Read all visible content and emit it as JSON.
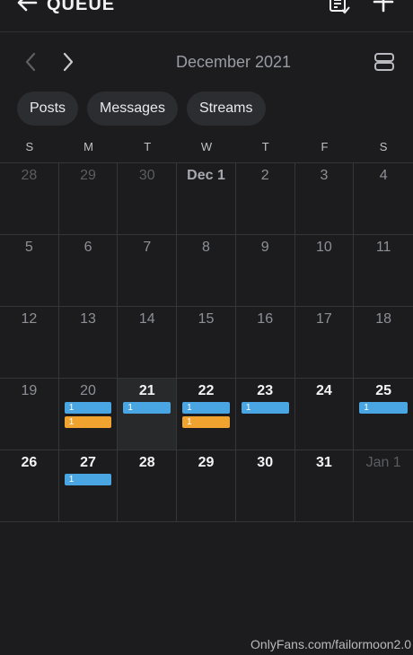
{
  "header": {
    "title": "QUEUE",
    "back_icon": "back-arrow-icon",
    "list_icon": "list-icon",
    "add_icon": "plus-icon"
  },
  "month_nav": {
    "label": "December 2021",
    "prev_icon": "chevron-left-icon",
    "next_icon": "chevron-right-icon",
    "view_icon": "calendar-view-icon"
  },
  "filters": [
    "Posts",
    "Messages",
    "Streams"
  ],
  "weekdays": [
    "S",
    "M",
    "T",
    "W",
    "T",
    "F",
    "S"
  ],
  "days": [
    {
      "label": "28",
      "style": "other",
      "badges": []
    },
    {
      "label": "29",
      "style": "other",
      "badges": []
    },
    {
      "label": "30",
      "style": "other",
      "badges": []
    },
    {
      "label": "Dec 1",
      "style": "month-start",
      "badges": []
    },
    {
      "label": "2",
      "style": "normal",
      "badges": []
    },
    {
      "label": "3",
      "style": "normal",
      "badges": []
    },
    {
      "label": "4",
      "style": "normal",
      "badges": []
    },
    {
      "label": "5",
      "style": "normal",
      "badges": []
    },
    {
      "label": "6",
      "style": "normal",
      "badges": []
    },
    {
      "label": "7",
      "style": "normal",
      "badges": []
    },
    {
      "label": "8",
      "style": "normal",
      "badges": []
    },
    {
      "label": "9",
      "style": "normal",
      "badges": []
    },
    {
      "label": "10",
      "style": "normal",
      "badges": []
    },
    {
      "label": "11",
      "style": "normal",
      "badges": []
    },
    {
      "label": "12",
      "style": "normal",
      "badges": []
    },
    {
      "label": "13",
      "style": "normal",
      "badges": []
    },
    {
      "label": "14",
      "style": "normal",
      "badges": []
    },
    {
      "label": "15",
      "style": "normal",
      "badges": []
    },
    {
      "label": "16",
      "style": "normal",
      "badges": []
    },
    {
      "label": "17",
      "style": "normal",
      "badges": []
    },
    {
      "label": "18",
      "style": "normal",
      "badges": []
    },
    {
      "label": "19",
      "style": "normal",
      "badges": []
    },
    {
      "label": "20",
      "style": "normal",
      "badges": [
        {
          "text": "1",
          "color": "blue"
        },
        {
          "text": "1",
          "color": "orange"
        }
      ]
    },
    {
      "label": "21",
      "style": "bright",
      "selected": true,
      "badges": [
        {
          "text": "1",
          "color": "blue"
        }
      ]
    },
    {
      "label": "22",
      "style": "bright",
      "badges": [
        {
          "text": "1",
          "color": "blue"
        },
        {
          "text": "1",
          "color": "orange"
        }
      ]
    },
    {
      "label": "23",
      "style": "bright",
      "badges": [
        {
          "text": "1",
          "color": "blue"
        }
      ]
    },
    {
      "label": "24",
      "style": "bright",
      "badges": []
    },
    {
      "label": "25",
      "style": "bright",
      "badges": [
        {
          "text": "1",
          "color": "blue"
        }
      ]
    },
    {
      "label": "26",
      "style": "bright",
      "badges": []
    },
    {
      "label": "27",
      "style": "bright",
      "badges": [
        {
          "text": "1",
          "color": "blue"
        }
      ]
    },
    {
      "label": "28",
      "style": "bright",
      "badges": []
    },
    {
      "label": "29",
      "style": "bright",
      "badges": []
    },
    {
      "label": "30",
      "style": "bright",
      "badges": []
    },
    {
      "label": "31",
      "style": "bright",
      "badges": []
    },
    {
      "label": "Jan 1",
      "style": "other",
      "badges": []
    }
  ],
  "colors": {
    "background": "#1c1c1e",
    "badge_blue": "#4aa6e2",
    "badge_orange": "#f0a32f",
    "chip_bg": "#2c2d30"
  },
  "watermark": "OnlyFans.com/failormoon2.0"
}
